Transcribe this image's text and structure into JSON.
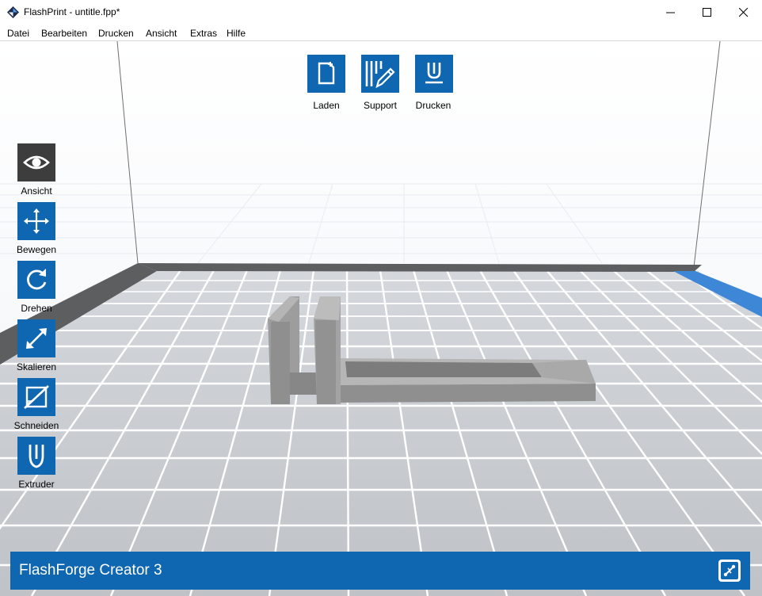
{
  "window": {
    "title": "FlashPrint - untitle.fpp*",
    "controls": [
      "minimize",
      "maximize",
      "close"
    ]
  },
  "menu": [
    {
      "label": "Datei"
    },
    {
      "label": "Bearbeiten"
    },
    {
      "label": "Drucken"
    },
    {
      "label": "Ansicht"
    },
    {
      "label": "Extras"
    },
    {
      "label": "Hilfe"
    }
  ],
  "top_toolbar": [
    {
      "label": "Laden",
      "icon": "load-file-icon"
    },
    {
      "label": "Support",
      "icon": "support-pencil-icon"
    },
    {
      "label": "Drucken",
      "icon": "print-nozzle-icon"
    }
  ],
  "side_toolbar": [
    {
      "label": "Ansicht",
      "icon": "eye-icon",
      "active": true
    },
    {
      "label": "Bewegen",
      "icon": "move-arrows-icon",
      "active": false
    },
    {
      "label": "Drehen",
      "icon": "rotate-icon",
      "active": false
    },
    {
      "label": "Skalieren",
      "icon": "scale-icon",
      "active": false
    },
    {
      "label": "Schneiden",
      "icon": "cut-icon",
      "active": false
    },
    {
      "label": "Extruder",
      "icon": "extruder-icon",
      "active": false
    }
  ],
  "status": {
    "printer": "FlashForge Creator 3",
    "connect_icon": "connect-printer-icon"
  },
  "colors": {
    "accent": "#0f66b1",
    "active_tool": "#3d3d3d",
    "model": "#9a9a9a",
    "plate": "#c2c6cb",
    "grid_lines": "#ffffff"
  }
}
